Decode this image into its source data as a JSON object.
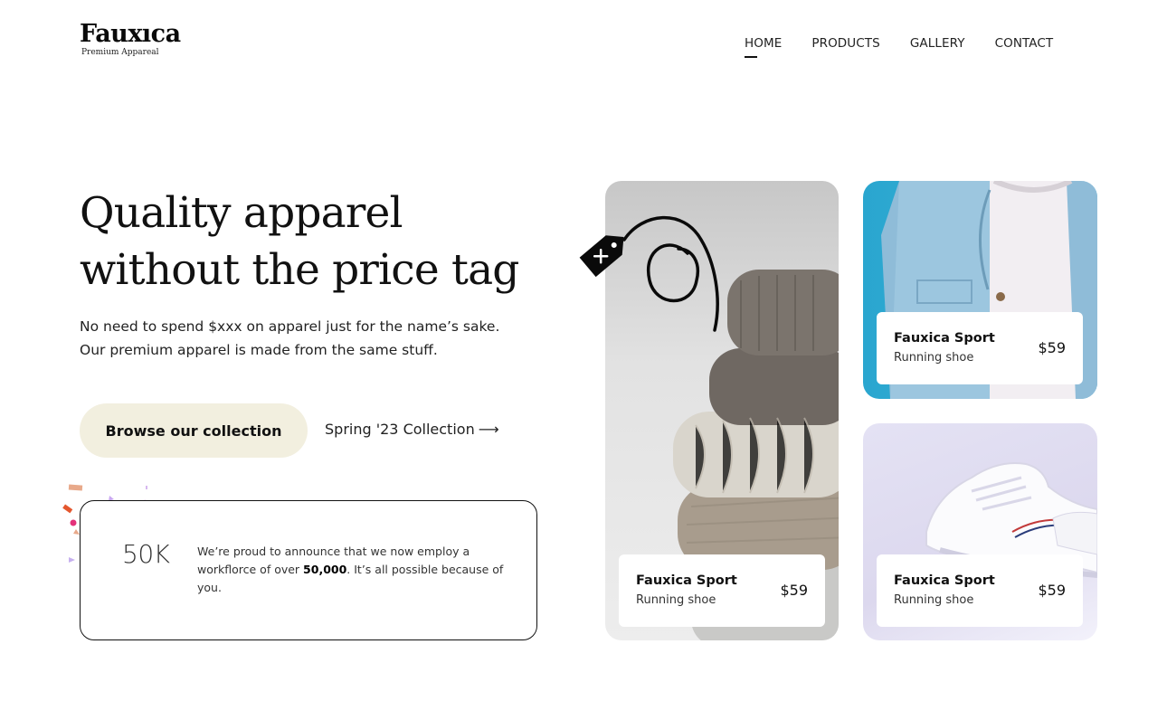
{
  "brand": {
    "name": "Fauxıca",
    "tagline": "Premium Appareal"
  },
  "nav": [
    {
      "label": "HOME",
      "active": true
    },
    {
      "label": "PRODUCTS",
      "active": false
    },
    {
      "label": "GALLERY",
      "active": false
    },
    {
      "label": "CONTACT",
      "active": false
    }
  ],
  "hero": {
    "headline_line1": "Quality apparel",
    "headline_line2": "without the price tag",
    "lede_line1": "No need to spend $xxx on apparel just for the name’s sake.",
    "lede_line2": "Our premium apparel is made from the same stuff.",
    "cta_label": "Browse our collection",
    "secondary_label": "Spring '23 Collection",
    "secondary_arrow": "⟶"
  },
  "stats": {
    "number": "50K",
    "text_before": "We’re proud to announce that we now employ a workflorce of over ",
    "text_bold": "50,000",
    "text_after": ". It’s all possible because of you."
  },
  "products": [
    {
      "name": "Fauxica Sport",
      "type": "Running shoe",
      "price": "$59"
    },
    {
      "name": "Fauxica Sport",
      "type": "Running shoe",
      "price": "$59"
    },
    {
      "name": "Fauxica Sport",
      "type": "Running shoe",
      "price": "$59"
    }
  ],
  "colors": {
    "cta_background": "#f2efdf",
    "text": "#111111",
    "denim_background": "#2aa6cf",
    "sneaker_background": "#e4e2f4"
  },
  "icons": {
    "price_tag": "price-tag-icon",
    "arrow": "arrow-right-icon"
  }
}
